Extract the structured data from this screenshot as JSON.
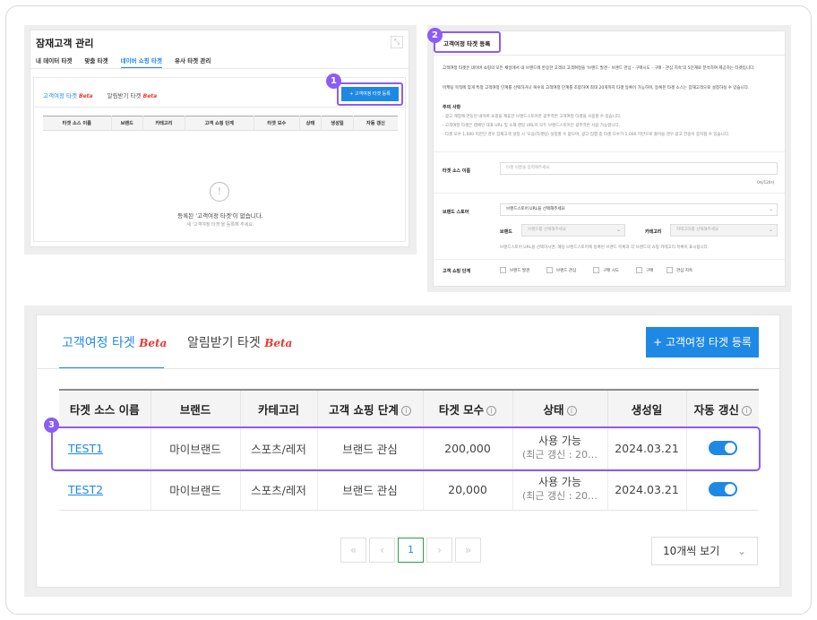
{
  "badges": [
    "1",
    "2",
    "3"
  ],
  "panel1": {
    "title": "잠재고객 관리",
    "expand_icon": "⤡",
    "subtabs": [
      "내 데이터 타겟",
      "맞춤 타겟",
      "네이버 쇼핑 타겟",
      "유사 타겟 관리"
    ],
    "active_subtab": 2,
    "inner_tab1": "고객여정 타겟",
    "inner_tab2": "알림받기 타겟",
    "beta": "Beta",
    "add_button": "+ 고객여정 타겟 등록",
    "columns": [
      "타겟 소스 이름",
      "브랜드",
      "카테고리",
      "고객 쇼핑 단계",
      "타겟 모수",
      "상태",
      "생성일",
      "자동 갱신"
    ],
    "empty_icon": "!",
    "empty_main": "등록된 '고객여정 타겟'이 없습니다.",
    "empty_sub": "새 '고객여정 타겟'을 등록해 주세요."
  },
  "panel2": {
    "title": "고객여정 타겟 등록",
    "desc1": "고객여정 타겟은 네이버 쇼핑의 모든 채널에서 내 브랜드에 반응한 고객의 고객여정을 '브랜드 발견 - 브랜드 관심 - 구매시도 - 구매 - 관심 지속'의 5단계로 분석하여 제공하는 타겟입니다.",
    "desc2": "마케팅 목적에 맞게 특정 고객여정 단계를 선택하거나 복수의 고객여정 단계를 조합하여 최대 20개까지 타겟 등록이 가능하며, 등록된 타겟 소스는 잠재고객으로 설정하실 수 있습니다.",
    "caution_title": "주의 사항",
    "caution1": "· 광고 계정에 연동된 네이버 쇼핑을 제휴한 브랜드스토어만 광주역번 고객여정 타겟을 사용할 수 있습니다.",
    "caution2": "· 고객여정 타겟은 캠페인 대표 URL 및 소재 랜딩 URL이 모두 브랜드스토어인 광주역번 사용 가능합니다.",
    "caution3": "· 타겟 모수 1,000 미만인 경우 잠재고객 설정 시 '모음(타겟팅) 설정할 수 없으며, 광고 집행 중 타겟 모수가 1,000 미만으로 줄어들 경우 광고 전송이 중지될 수 있습니다.",
    "source_label": "타겟 소스 이름",
    "source_placeholder": "타겟 이름을 입력해주세요.",
    "source_count": "0자/120자",
    "store_label": "브랜드 스토어",
    "store_select": "브랜드스토어 URL을 선택해주세요",
    "brand_label": "브랜드",
    "brand_select": "브랜드를 선택해주세요",
    "category_label": "카테고리",
    "category_select": "카테고리를 선택해주세요",
    "store_help": "브랜드스토어 URL을 선택하시면, 해당 브랜드스토어에 등록된 브랜드 목록과 각 브랜드의 쇼핑 카테고리 목록이 표시됩니다.",
    "stage_label": "고객 쇼핑 단계",
    "stages": [
      "브랜드 발견",
      "브랜드 관심",
      "구매 시도",
      "구매",
      "관심 지속"
    ],
    "caret": "⌄"
  },
  "panel3": {
    "tab1": "고객여정 타겟",
    "tab2": "알림받기 타겟",
    "beta": "Beta",
    "add_button": "+ 고객여정 타겟 등록",
    "columns": [
      "타겟 소스 이름",
      "브랜드",
      "카테고리",
      "고객 쇼핑 단계",
      "타겟 모수",
      "상태",
      "생성일",
      "자동 갱신"
    ],
    "info_icon": "i",
    "rows": [
      {
        "name": "TEST1",
        "brand": "마이브랜드",
        "category": "스포츠/레저",
        "stage": "브랜드 관심",
        "size": "200,000",
        "status": "사용 가능",
        "status_sub": "(최근 갱신 : 20…",
        "created": "2024.03.21"
      },
      {
        "name": "TEST2",
        "brand": "마이브랜드",
        "category": "스포츠/레저",
        "stage": "브랜드 관심",
        "size": "20,000",
        "status": "사용 가능",
        "status_sub": "(최근 갱신 : 20…",
        "created": "2024.03.21"
      }
    ],
    "pager": {
      "first": "«",
      "prev": "‹",
      "current": "1",
      "next": "›",
      "last": "»"
    },
    "per_page": "10개씩 보기",
    "chev": "⌄"
  }
}
